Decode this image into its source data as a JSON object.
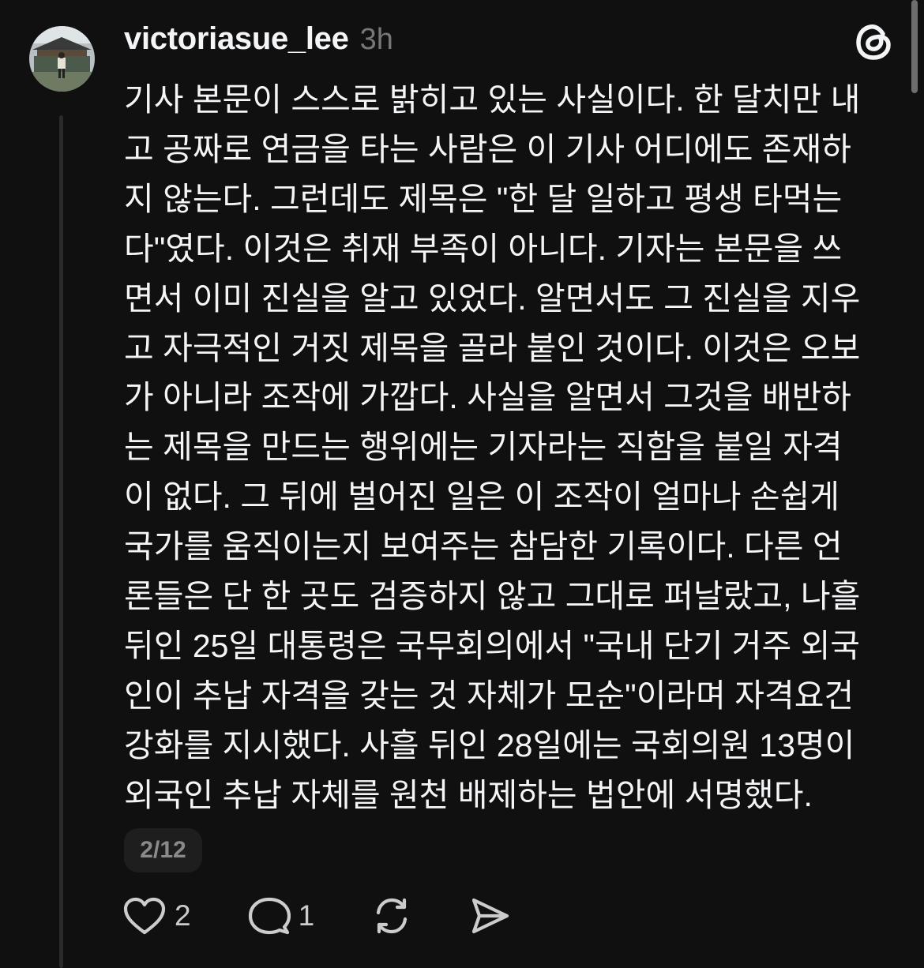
{
  "post": {
    "author": "victoriasue_lee",
    "time": "3h",
    "body_lines": [
      "기사 본문이 스스로 밝히고 있는 사실이다. 한 달치만 내",
      "고 공짜로 연금을 타는 사람은 이 기사 어디에도 존재하",
      "지 않는다. 그런데도 제목은 \"한 달 일하고 평생 타먹는",
      "다\"였다. 이것은 취재 부족이 아니다. 기자는 본문을 쓰",
      "면서 이미 진실을 알고 있었다. 알면서도 그 진실을 지우",
      "고 자극적인 거짓 제목을 골라 붙인 것이다. 이것은 오보",
      "가 아니라 조작에 가깝다. 사실을 알면서 그것을 배반하",
      "는 제목을 만드는 행위에는 기자라는 직함을 붙일 자격",
      "이 없다. 그 뒤에 벌어진 일은 이 조작이 얼마나 손쉽게",
      "국가를 움직이는지 보여주는 참담한 기록이다. 다른 언",
      "론들은 단 한 곳도 검증하지 않고 그대로 퍼날랐고, 나흘",
      "뒤인 25일 대통령은 국무회의에서 \"국내 단기 거주 외국",
      "인이 추납 자격을 갖는 것 자체가 모순\"이라며 자격요건",
      "강화를 지시했다. 사흘 뒤인 28일에는 국회의원 13명이",
      "외국인 추납 자체를 원천 배제하는 법안에 서명했다."
    ],
    "page_indicator": "2/12",
    "likes": "2",
    "replies": "1"
  },
  "icons": {
    "app_logo": "threads-logo-icon",
    "like": "heart-icon",
    "reply": "comment-bubble-icon",
    "repost": "repost-icon",
    "share": "send-icon"
  },
  "colors": {
    "background": "#101010",
    "text": "#f3f5f7",
    "muted": "#777777",
    "thread_line": "#2a2a2a",
    "badge_bg": "#1e1e1e"
  }
}
